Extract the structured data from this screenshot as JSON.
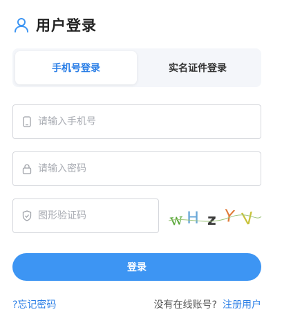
{
  "header": {
    "title": "用户登录",
    "icon": "user-icon"
  },
  "tabs": [
    {
      "label": "手机号登录",
      "active": true
    },
    {
      "label": "实名证件登录",
      "active": false
    }
  ],
  "form": {
    "phone_placeholder": "请输入手机号",
    "password_placeholder": "请输入密码",
    "captcha_placeholder": "图形验证码",
    "captcha_text": "wHzYV"
  },
  "login_label": "登录",
  "footer": {
    "forgot_label": "?忘记密码",
    "no_account_text": "没有在线账号?",
    "register_label": "注册用户"
  },
  "colors": {
    "accent": "#3d95f3",
    "link": "#2a7ee6"
  }
}
